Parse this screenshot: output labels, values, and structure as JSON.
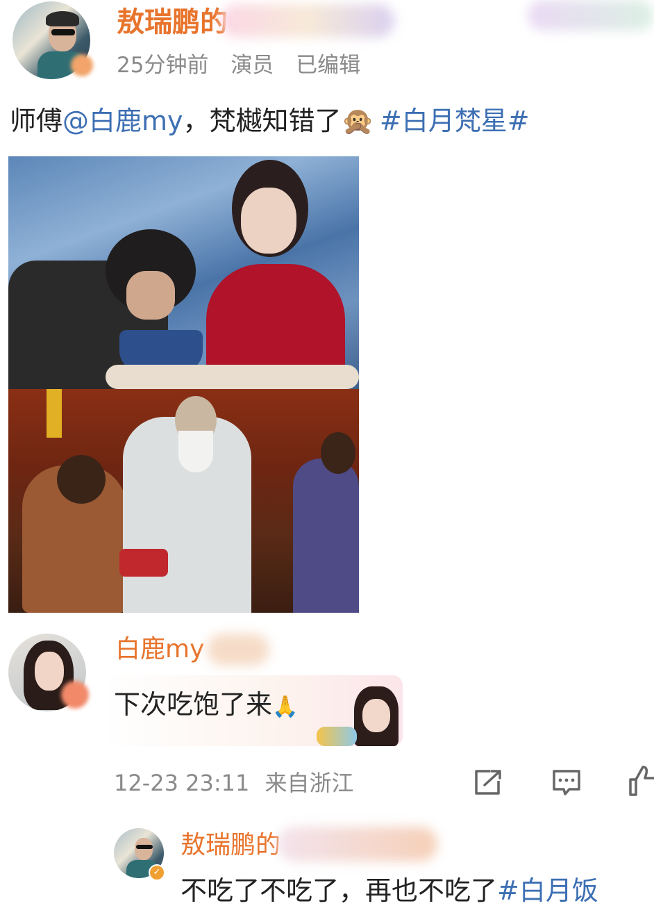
{
  "post": {
    "author_name": "敖瑞鹏的",
    "time": "25分钟前",
    "badge": "演员",
    "edited": "已编辑",
    "text_prefix": "师傅",
    "mention": "@白鹿my",
    "text_middle": "，梵樾知错了",
    "emoji": "🙊",
    "hashtag": "#白月梵星#"
  },
  "reply": {
    "author_name": "白鹿my",
    "text": "下次吃饱了来",
    "emoji": "🙏",
    "timestamp": "12-23 23:11",
    "location": "来自浙江"
  },
  "sub_reply": {
    "author_name": "敖瑞鹏的",
    "text": "不吃了不吃了，再也不吃了",
    "hashtag": "#白月饭"
  },
  "actions": {
    "share": "share-icon",
    "comment": "comment-icon",
    "like": "like-icon"
  },
  "colors": {
    "name": "#e8742c",
    "topic": "#3d6fb3",
    "meta": "#8a8a8a"
  }
}
